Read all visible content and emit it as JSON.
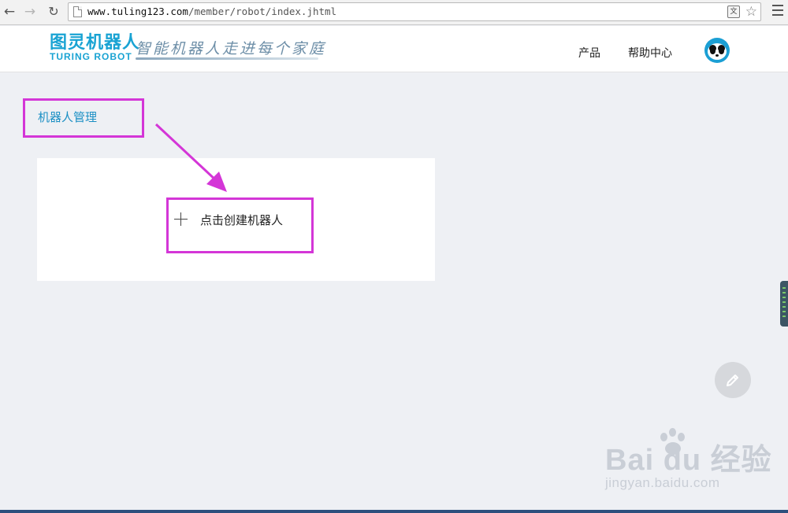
{
  "browser": {
    "url_host": "www.tuling123.com",
    "url_path": "/member/robot/index.jhtml",
    "icons": [
      "back-icon",
      "forward-icon",
      "reload-icon",
      "page-icon",
      "translate-icon",
      "star-icon",
      "menu-icon"
    ]
  },
  "header": {
    "logo_cn": "图灵机器人",
    "logo_en": "TURING ROBOT",
    "slogan": "智能机器人走进每个家庭",
    "nav": [
      "产品",
      "帮助中心"
    ],
    "avatar_icon": "panda-avatar-icon"
  },
  "main": {
    "section_title": "机器人管理",
    "create_button_label": "点击创建机器人"
  },
  "floating": {
    "edit_icon": "pencil-icon"
  },
  "watermark": {
    "main": "Bai du 经验",
    "sub": "jingyan.baidu.com"
  },
  "colors": {
    "accent": "#1b8fc4",
    "annotation": "#d436d7",
    "page_bg": "#eef0f4"
  }
}
